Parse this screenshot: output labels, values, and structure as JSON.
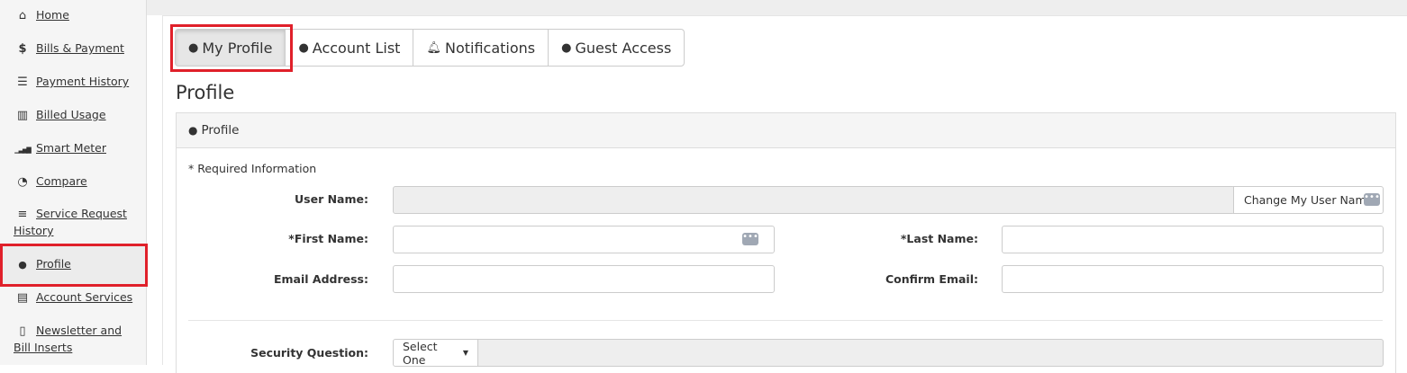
{
  "sidebar": {
    "items": [
      {
        "label": "Home",
        "icon": "home-icon",
        "glyph": "⌂"
      },
      {
        "label": "Bills & Payment",
        "icon": "dollar-icon",
        "glyph": "$"
      },
      {
        "label": "Payment History",
        "icon": "list-icon",
        "glyph": "☰"
      },
      {
        "label": "Billed Usage",
        "icon": "bar-chart-icon",
        "glyph": "▥"
      },
      {
        "label": "Smart Meter",
        "icon": "signal-icon",
        "glyph": "▁▃▅▇"
      },
      {
        "label": "Compare",
        "icon": "dashboard-icon",
        "glyph": "◔"
      },
      {
        "label": "Service Request History",
        "icon": "server-icon",
        "glyph": "≡"
      },
      {
        "label": "Profile",
        "icon": "user-icon",
        "glyph": "●"
      },
      {
        "label": "Account Services",
        "icon": "document-icon",
        "glyph": "▤"
      },
      {
        "label": "Newsletter and Bill Inserts",
        "icon": "file-text-icon",
        "glyph": "▯"
      }
    ]
  },
  "tabs": [
    {
      "label": "My Profile"
    },
    {
      "label": "Account List"
    },
    {
      "label": "Notifications"
    },
    {
      "label": "Guest Access"
    }
  ],
  "page_title": "Profile",
  "panel": {
    "heading": "Profile",
    "required_note": "* Required Information",
    "user_name_label": "User Name:",
    "user_name_value": "",
    "change_user_name_label": "Change My User Name",
    "first_name_label": "*First Name:",
    "first_name_value": "",
    "last_name_label": "*Last Name:",
    "last_name_value": "",
    "email_label": "Email Address:",
    "email_value": "",
    "confirm_email_label": "Confirm Email:",
    "confirm_email_value": "",
    "security_question_label": "Security Question:",
    "security_question_selected": "Select One"
  },
  "colors": {
    "highlight": "#e0202a",
    "sidebar_bg": "#f5f5f5"
  }
}
